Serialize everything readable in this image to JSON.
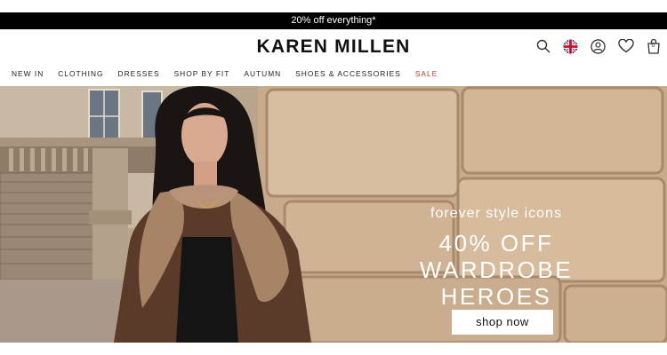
{
  "promo": {
    "text": "20% off everything*"
  },
  "header": {
    "logo": "KAREN MILLEN",
    "icons": [
      "search-icon",
      "uk-flag-icon",
      "account-icon",
      "wishlist-heart-icon",
      "bag-icon"
    ],
    "bag_count": "0"
  },
  "nav": {
    "items": [
      "NEW IN",
      "CLOTHING",
      "DRESSES",
      "SHOP BY FIT",
      "AUTUMN",
      "SHOES & ACCESSORIES",
      "SALE"
    ]
  },
  "hero": {
    "kicker": "forever style icons",
    "headline_line1": "40% OFF",
    "headline_line2": "WARDROBE HEROES",
    "cta": "shop now"
  },
  "colors": {
    "promo_bg": "#000000",
    "sale": "#c0392b",
    "text": "#111111"
  }
}
